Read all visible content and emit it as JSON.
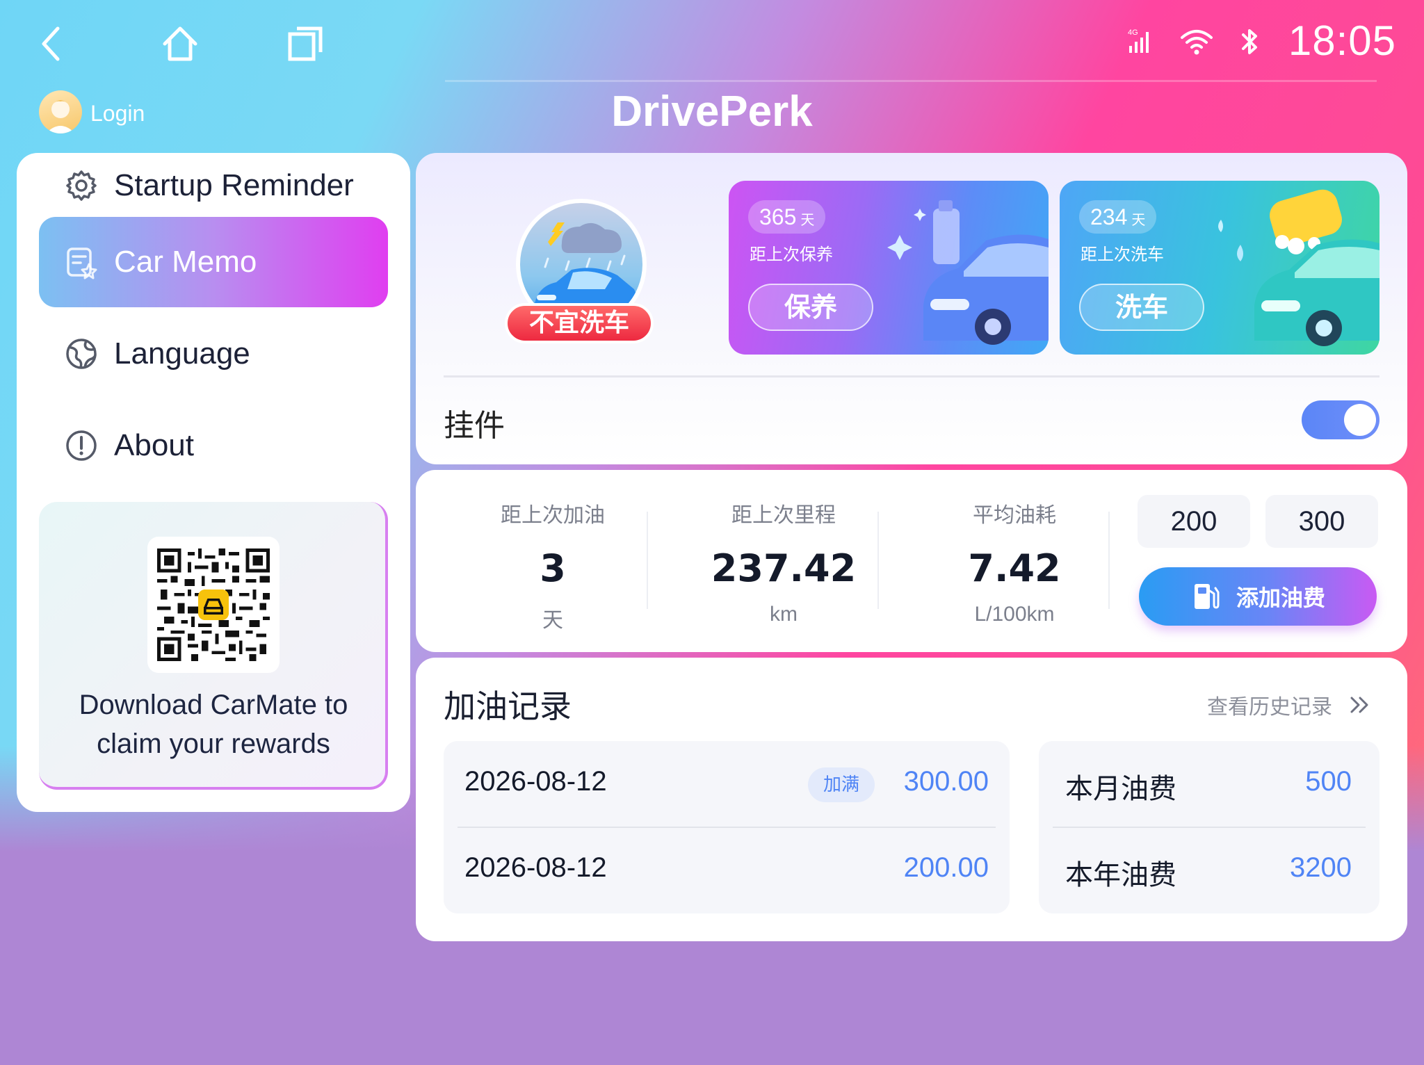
{
  "status_bar": {
    "time": "18:05",
    "signal_label": "4G"
  },
  "header": {
    "login_label": "Login",
    "app_title": "DrivePerk"
  },
  "sidebar": {
    "items": [
      {
        "label": "Startup Reminder",
        "icon": "gear-icon",
        "active": false
      },
      {
        "label": "Car Memo",
        "icon": "memo-icon",
        "active": true
      },
      {
        "label": "Language",
        "icon": "globe-icon",
        "active": false
      },
      {
        "label": "About",
        "icon": "info-icon",
        "active": false
      }
    ],
    "promo": {
      "line1": "Download CarMate to",
      "line2": "claim your rewards"
    }
  },
  "car_wash_status": {
    "badge": "不宜洗车"
  },
  "tiles": [
    {
      "days": "365",
      "unit": "天",
      "subtitle": "距上次保养",
      "button": "保养"
    },
    {
      "days": "234",
      "unit": "天",
      "subtitle": "距上次洗车",
      "button": "洗车"
    }
  ],
  "widget": {
    "label": "挂件",
    "enabled": true
  },
  "stats": [
    {
      "title": "距上次加油",
      "value": "3",
      "unit": "天"
    },
    {
      "title": "距上次里程",
      "value": "237.42",
      "unit": "km"
    },
    {
      "title": "平均油耗",
      "value": "7.42",
      "unit": "L/100km"
    }
  ],
  "quick_amounts": [
    "200",
    "300"
  ],
  "add_fuel_label": "添加油费",
  "records": {
    "title": "加油记录",
    "history_link": "查看历史记录",
    "rows": [
      {
        "date": "2026-08-12",
        "tag": "加满",
        "amount": "300.00"
      },
      {
        "date": "2026-08-12",
        "tag": "",
        "amount": "200.00"
      }
    ],
    "summary": [
      {
        "label": "本月油费",
        "value": "500"
      },
      {
        "label": "本年油费",
        "value": "3200"
      }
    ]
  },
  "colors": {
    "accent_blue": "#4f84f5",
    "active_gradient_end": "#e03ef0",
    "badge_red": "#ed2940"
  }
}
